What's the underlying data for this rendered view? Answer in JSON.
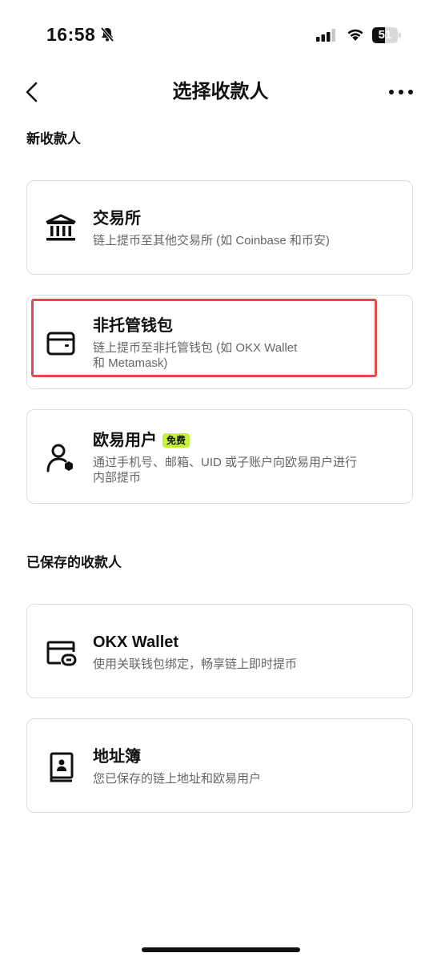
{
  "status_bar": {
    "time": "16:58",
    "battery": "51"
  },
  "nav": {
    "title": "选择收款人"
  },
  "sections": {
    "new": "新收款人",
    "saved": "已保存的收款人"
  },
  "new_recipients": [
    {
      "title": "交易所",
      "desc": "链上提币至其他交易所 (如 Coinbase 和币安)",
      "icon": "bank-icon"
    },
    {
      "title": "非托管钱包",
      "desc_line1": "链上提币至非托管钱包 (如 OKX Wallet",
      "desc_line2": "和 Metamask)",
      "icon": "wallet-icon"
    },
    {
      "title": "欧易用户",
      "badge": "免费",
      "desc_line1": "通过手机号、邮箱、UID 或子账户向欧易用户进行",
      "desc_line2": "内部提币",
      "icon": "user-icon"
    }
  ],
  "saved_recipients": [
    {
      "title": "OKX Wallet",
      "desc": "使用关联钱包绑定，畅享链上即时提币",
      "icon": "linked-wallet-icon"
    },
    {
      "title": "地址簿",
      "desc": "您已保存的链上地址和欧易用户",
      "icon": "address-book-icon"
    }
  ],
  "colors": {
    "badge": "#c4f23a",
    "highlight": "#e5484d",
    "text": "#111111",
    "muted": "#666666"
  }
}
